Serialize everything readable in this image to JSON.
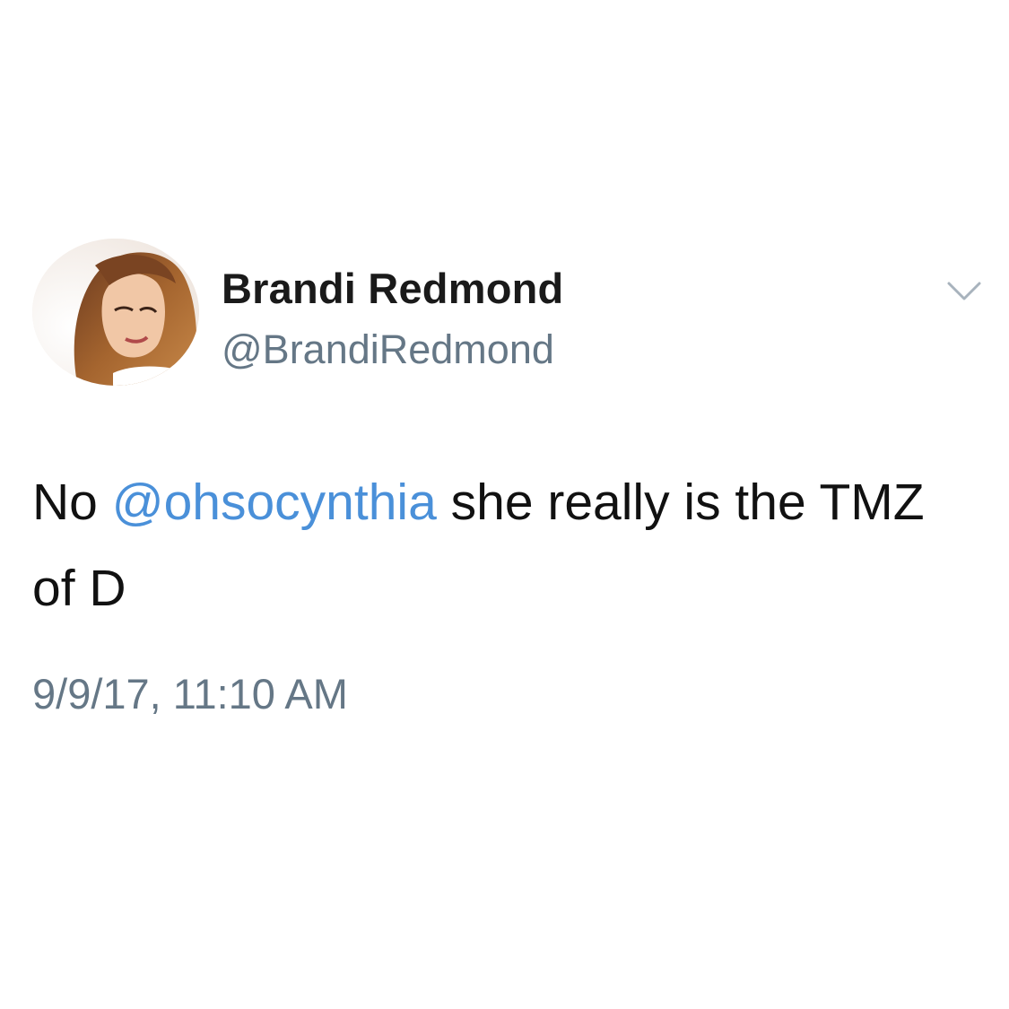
{
  "tweet": {
    "author": {
      "display_name": "Brandi Redmond",
      "handle": "@BrandiRedmond",
      "avatar_icon": "profile-photo"
    },
    "menu_icon": "chevron-down-icon",
    "text": {
      "before": "No ",
      "mention": "@ohsocynthia",
      "after": " she really is the TMZ of D"
    },
    "timestamp": "9/9/17, 11:10 AM",
    "colors": {
      "mention": "#4a90d9",
      "secondary_text": "#657786",
      "primary_text": "#111111"
    }
  }
}
